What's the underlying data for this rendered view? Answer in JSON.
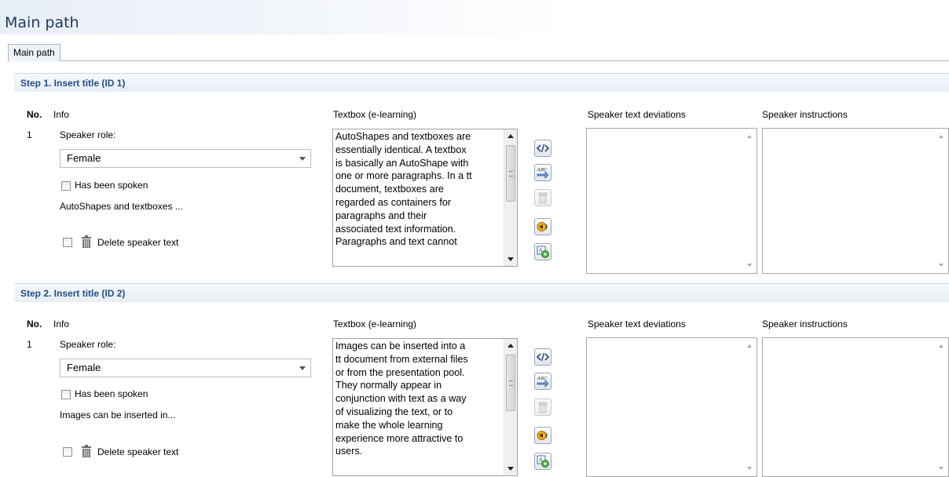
{
  "page_title": "Main path",
  "tab_label": "Main path",
  "column_labels": {
    "no": "No.",
    "info": "Info",
    "textbox": "Textbox (e-learning)",
    "deviations": "Speaker text deviations",
    "instructions": "Speaker instructions"
  },
  "steps": [
    {
      "header": "Step 1. Insert title (ID 1)",
      "number": "1",
      "speaker_role_label": "Speaker role:",
      "speaker_role_value": "Female",
      "has_been_spoken_label": "Has been spoken",
      "has_been_spoken": false,
      "preview": "AutoShapes and textboxes ...",
      "delete_label": "Delete speaker text",
      "textbox_lines": [
        "AutoShapes and textboxes are",
        "essentially identical. A textbox",
        "is basically an AutoShape with",
        "one or more paragraphs. In a tt",
        "document, textboxes are",
        "regarded as containers for",
        "paragraphs and their",
        "associated text information.",
        "Paragraphs and text cannot"
      ]
    },
    {
      "header": "Step 2. Insert title (ID 2)",
      "number": "1",
      "speaker_role_label": "Speaker role:",
      "speaker_role_value": "Female",
      "has_been_spoken_label": "Has been spoken",
      "has_been_spoken": false,
      "preview": "Images can be inserted in...",
      "delete_label": "Delete speaker text",
      "textbox_lines": [
        "Images can be inserted into a",
        "tt document from external files",
        "or from the presentation pool.",
        "They normally appear in",
        "conjunction with text as a way",
        "of visualizing the text, or to",
        "make the whole learning",
        "experience more attractive to",
        "users."
      ]
    }
  ],
  "toolbar_icons": [
    "code-tag-icon",
    "spell-check-icon",
    "trash-icon",
    "speaker-audio-icon",
    "text-to-speech-icon"
  ],
  "colors": {
    "header_text": "#1f4e86",
    "title_text": "#1f3a5c",
    "tab_border": "#a9b6c6"
  }
}
